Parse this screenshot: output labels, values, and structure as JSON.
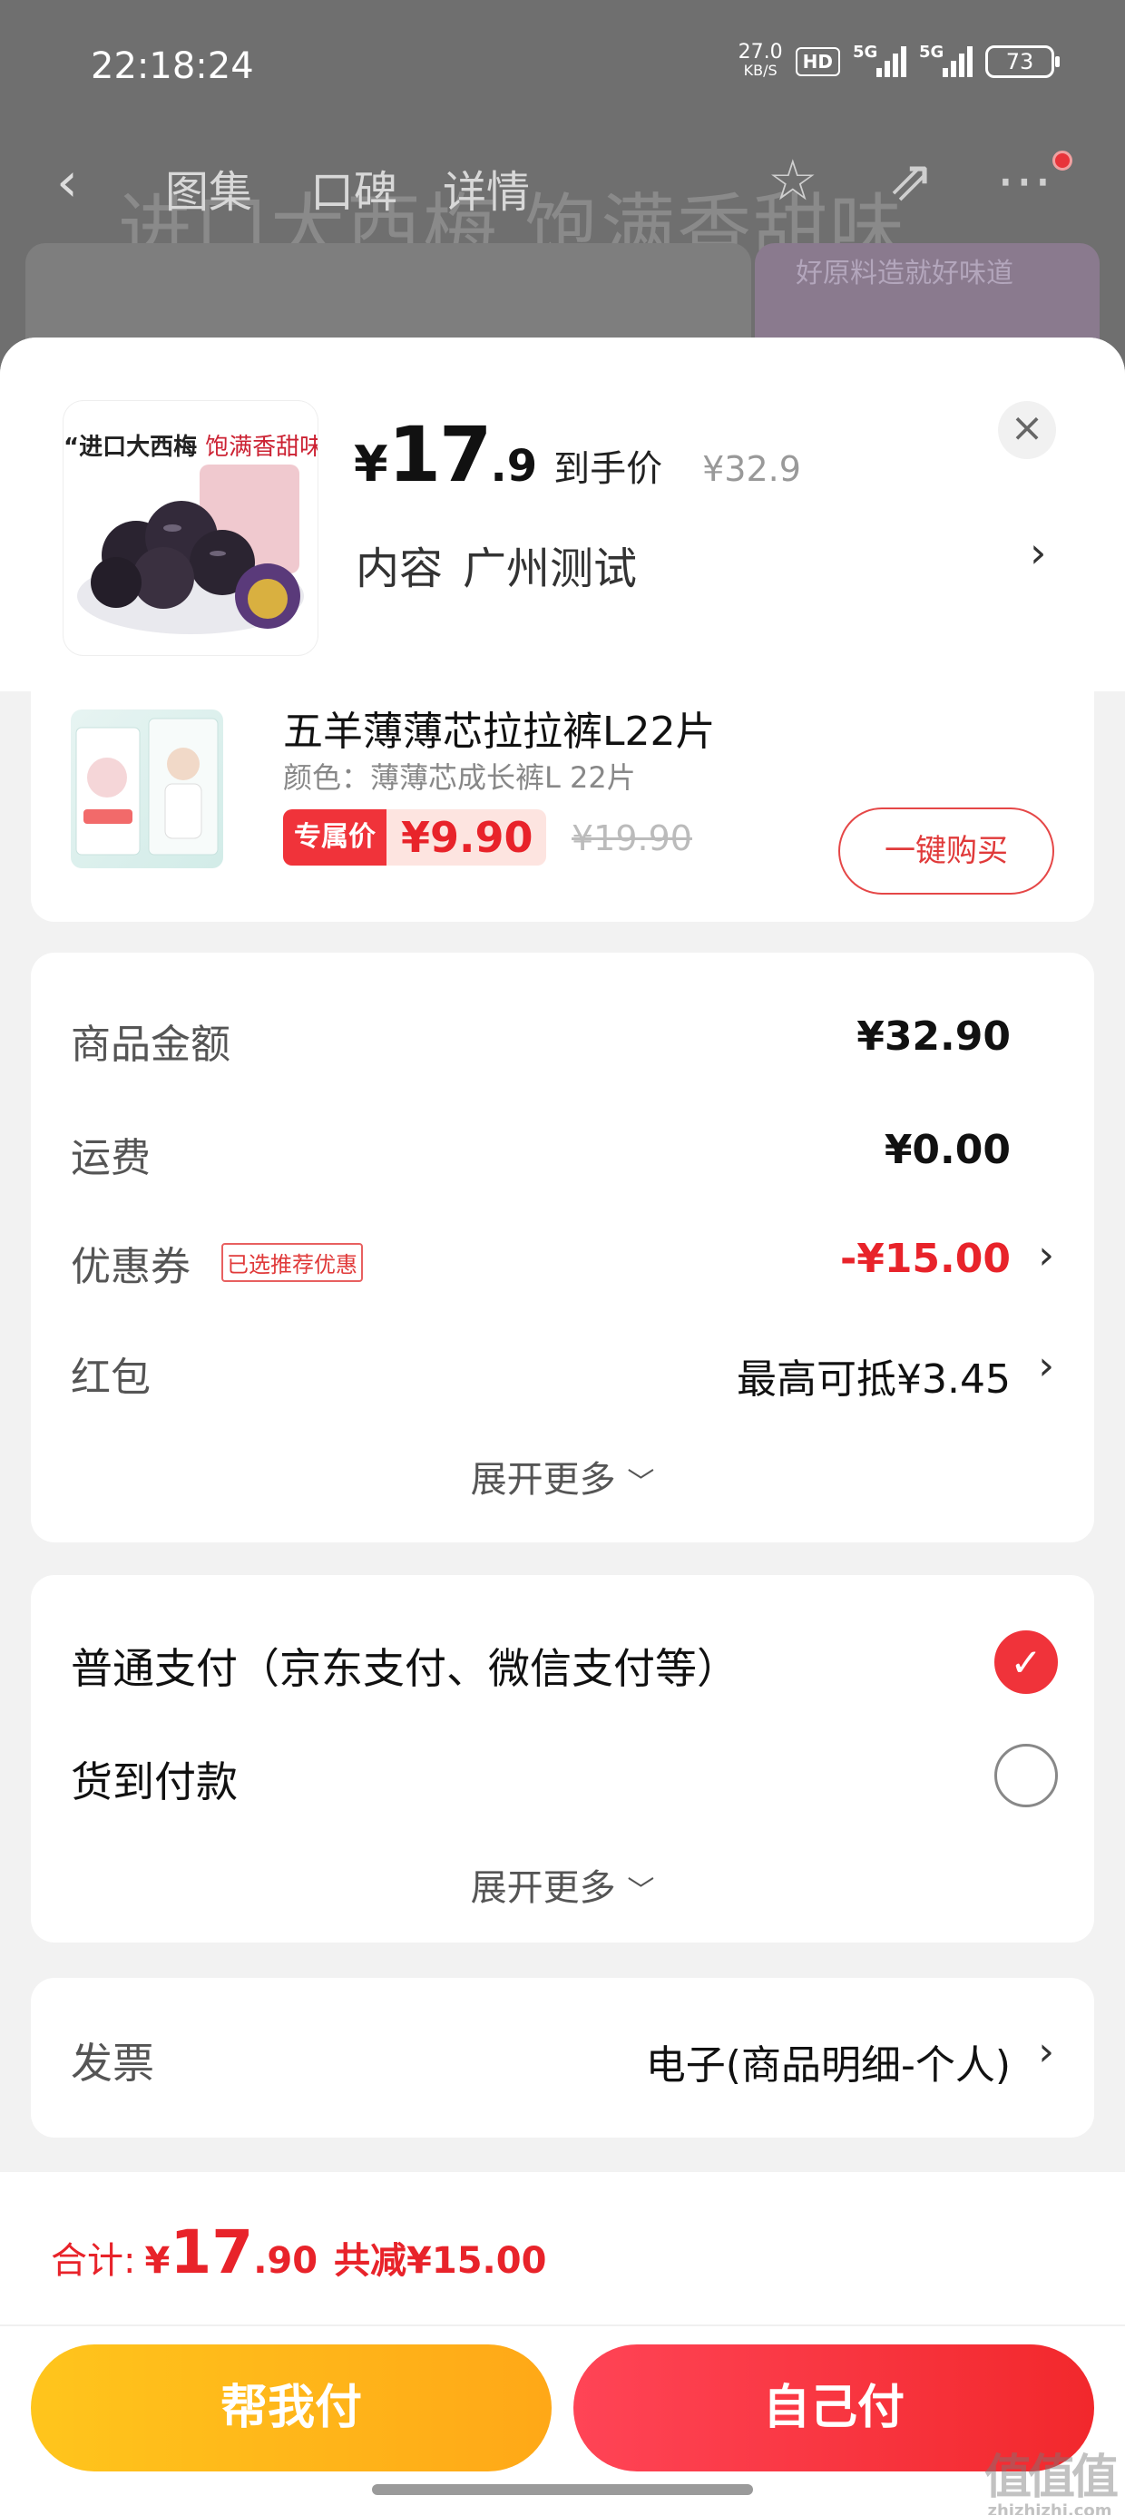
{
  "status_bar": {
    "time": "22:18:24",
    "net_speed": "27.0",
    "net_unit": "KB/S",
    "hd_badge": "HD",
    "sig1_label": "5G",
    "sig2_label": "5G",
    "battery": "73"
  },
  "background_page": {
    "tabs": [
      "图集",
      "口碑",
      "详情"
    ],
    "headline": "进口大西梅 饱满香甜味",
    "banner_text": "好原料造就好味道"
  },
  "product": {
    "image_caption_main": "“进口大西梅",
    "image_caption_sub": "饱满香甜味”",
    "currency": "¥",
    "price_int": "17",
    "price_dec": ".9",
    "price_label": "到手价",
    "original_price": "¥32.9",
    "spec_label": "内容",
    "spec_value": "广州测试"
  },
  "recommend": {
    "title": "五羊薄薄芯拉拉裤L22片",
    "color": "颜色：薄薄芯成长裤L 22片",
    "tag": "专属价",
    "price": "¥9.90",
    "old_price": "¥19.90",
    "buy_label": "一键购买"
  },
  "fees": {
    "goods_label": "商品金额",
    "goods_value": "¥32.90",
    "shipping_label": "运费",
    "shipping_value": "¥0.00",
    "coupon_label": "优惠券",
    "coupon_badge": "已选推荐优惠",
    "coupon_value": "-¥15.00",
    "redpacket_label": "红包",
    "redpacket_value": "最高可抵¥3.45",
    "more": "展开更多"
  },
  "payment": {
    "normal": "普通支付（京东支付、微信支付等）",
    "cod": "货到付款",
    "more": "展开更多"
  },
  "invoice": {
    "label": "发票",
    "value": "电子(商品明细-个人)"
  },
  "footer": {
    "total_label": "合计:",
    "currency": "¥",
    "total_int": "17",
    "total_dec": ".90",
    "discount": "共减¥15.00",
    "help_pay": "帮我付",
    "self_pay": "自己付"
  },
  "watermark": {
    "mark": "值值值",
    "site": "zhizhizhi.com"
  },
  "colors": {
    "accent_red": "#e8232a",
    "help_button": "#ffb81a",
    "self_button": "#f2282c"
  }
}
